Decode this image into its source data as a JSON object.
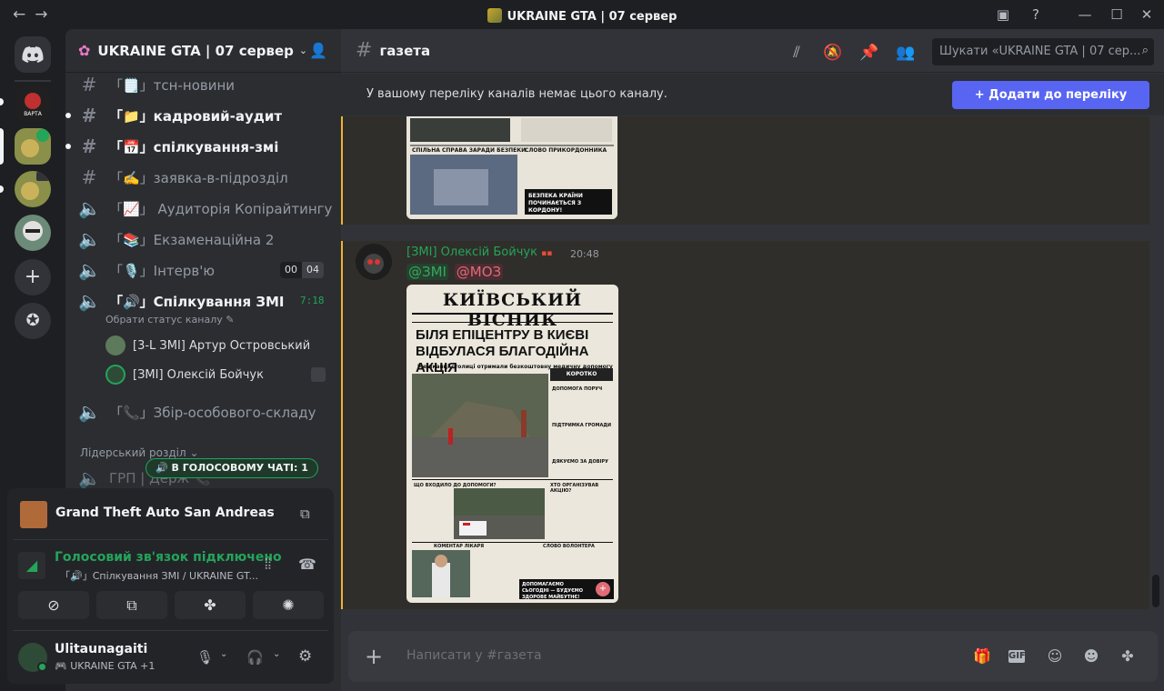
{
  "window": {
    "title": "UKRAINE GTA | 07 сервер"
  },
  "server": {
    "name": "UKRAINE GTA | 07 сервер"
  },
  "channels": [
    {
      "label": "「🗒️」тсн-новини",
      "type": "text",
      "unread": false
    },
    {
      "label": "「📁」кадровий-аудит",
      "type": "text",
      "unread": true
    },
    {
      "label": "「📅」спілкування-змі",
      "type": "text",
      "unread": true
    },
    {
      "label": "「✍️」заявка-в-підрозділ",
      "type": "text",
      "unread": false
    },
    {
      "label": "「📈」 Аудиторія Копірайтингу",
      "type": "voice",
      "unread": false
    },
    {
      "label": "「📚」Екзаменаційна 2",
      "type": "voice",
      "unread": false
    },
    {
      "label": "「🎙️」Інтерв'ю",
      "type": "voice",
      "unread": false
    },
    {
      "label": "「🔊」Спілкування ЗМІ",
      "type": "voice",
      "unread": true
    },
    {
      "label": "「📞」Збір-особового-складу",
      "type": "voice",
      "unread": false
    }
  ],
  "interview_counts": {
    "left": "00",
    "right": "04"
  },
  "voice_time": "7:18",
  "voice_status_hint": "Обрати статус каналу ✎",
  "voice_users": [
    "[3-L ЗМІ] Артур Островський",
    "[ЗМІ] Олексій Бойчук"
  ],
  "category": "Лідерський розділ ⌄",
  "partial_channel": "ГРП | Держ 📞",
  "voice_chat_badge": "🔊 В ГОЛОСОВОМУ ЧАТІ: 1",
  "activity": {
    "game": "Grand Theft Auto San Andreas"
  },
  "voice_connection": {
    "status": "Голосовий зв'язок підключено",
    "channel": "「🔊」Спілкування ЗМІ / UKRAINE GT..."
  },
  "user": {
    "name": "Ulitaunagaiti",
    "status": "🎮 UKRAINE GTA +1"
  },
  "current_channel": {
    "name": "газета"
  },
  "search": {
    "placeholder": "Шукати «UKRAINE GTA | 07 сер..."
  },
  "notice": {
    "text": "У вашому переліку каналів немає цього каналу.",
    "button": "+ Додати до переліку каналів"
  },
  "message": {
    "author": "[ЗМІ] Олексій Бойчук",
    "time": "20:48",
    "mentions": [
      "@ЗМІ",
      "@МОЗ"
    ]
  },
  "newspaper_top": {
    "section_left": "СПІЛЬНА СПРАВА ЗАРАДИ БЕЗПЕКИ",
    "section_right": "СЛОВО ПРИКОРДОННИКА",
    "banner": "БЕЗПЕКА КРАЇНИ ПОЧИНАЄТЬСЯ З КОРДОНУ!"
  },
  "newspaper": {
    "masthead": "КИЇВСЬКИЙ ВІСНИК",
    "headline": "БІЛЯ ЕПІЦЕНТРУ В КИЄВІ ВІДБУЛАСЯ БЛАГОДІЙНА АКЦІЯ",
    "subhead": "Мешканці столиці отримали безкоштовну медичну допомогу",
    "box_title": "КОРОТКО",
    "box_items": [
      "ДОПОМОГА ПОРУЧ",
      "ПІДТРИМКА ГРОМАДИ",
      "ДЯКУЄМО ЗА ДОВІРУ"
    ],
    "section_a": "ЩО ВХОДИЛО ДО ДОПОМОГИ?",
    "section_b": "ХТО ОРГАНІЗУВАВ АКЦІЮ?",
    "section_c": "КОМЕНТАР ЛІКАРЯ",
    "section_d": "СЛОВО ВОЛОНТЕРА",
    "footer": "ДОПОМАГАЄМО СЬОГОДНІ — БУДУЄМО ЗДОРОВЕ МАЙБУТНЄ!"
  },
  "composer": {
    "placeholder": "Написати у #газета"
  },
  "colors": {
    "accent": "#5865f2",
    "green": "#23a55a",
    "mention_zmi": "#3ba55c",
    "mention_moz": "#e06c75"
  }
}
